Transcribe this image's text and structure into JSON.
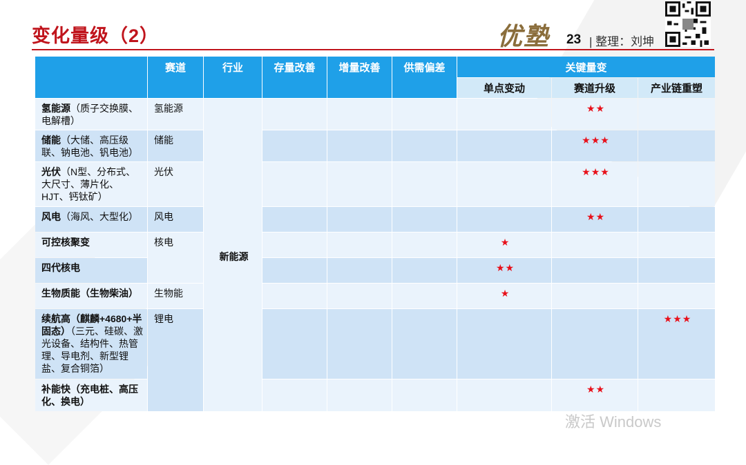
{
  "page": {
    "title": "变化量级（2）",
    "brand": "优塾",
    "page_number": "23",
    "compiler": "| 整理：刘坤",
    "watermark": "激活 Windows"
  },
  "table": {
    "headers": [
      "",
      "赛道",
      "行业",
      "存量改善",
      "增量改善",
      "供需偏差",
      "关键量变"
    ],
    "sub_headers": [
      "单点变动",
      "赛道升级",
      "产业链重塑"
    ],
    "industry": "新能源",
    "rows": [
      {
        "name": "氢能源",
        "detail": "（质子交换膜、电解槽）",
        "track": "氢能源",
        "single": "",
        "upgrade": "★★",
        "chain": ""
      },
      {
        "name": "储能",
        "detail": "（大储、高压级联、钠电池、钒电池）",
        "track": "储能",
        "single": "",
        "upgrade": "★★★",
        "chain": ""
      },
      {
        "name": "光伏",
        "detail": "（N型、分布式、大尺寸、薄片化、HJT、钙钛矿）",
        "track": "光伏",
        "single": "",
        "upgrade": "★★★",
        "chain": ""
      },
      {
        "name": "风电",
        "detail": "（海风、大型化）",
        "track": "风电",
        "single": "",
        "upgrade": "★★",
        "chain": ""
      },
      {
        "name": "可控核聚变",
        "detail": "",
        "track": "核电",
        "single": "★",
        "upgrade": "",
        "chain": ""
      },
      {
        "name": "四代核电",
        "detail": "",
        "track": "",
        "single": "★★",
        "upgrade": "",
        "chain": ""
      },
      {
        "name": "生物质能（生物柴油）",
        "detail": "",
        "track": "生物能",
        "single": "★",
        "upgrade": "",
        "chain": ""
      },
      {
        "name": "续航高（麒麟+4680+半固态）",
        "detail": "（三元、硅碳、激光设备、结构件、热管理、导电剂、新型锂盐、复合铜箔）",
        "track": "锂电",
        "single": "",
        "upgrade": "",
        "chain": "★★★"
      },
      {
        "name": "补能快（充电桩、高压化、换电）",
        "detail": "",
        "track": "",
        "single": "",
        "upgrade": "★★",
        "chain": ""
      }
    ]
  },
  "colors": {
    "title": "#c0141c",
    "header": "#1fa0e8",
    "sub_header": "#d2e9f8",
    "row_light": "#eaf3fc",
    "row_dark": "#cfe3f6",
    "star": "#e8101a"
  },
  "icons": {
    "qr": "qr-code-icon"
  }
}
